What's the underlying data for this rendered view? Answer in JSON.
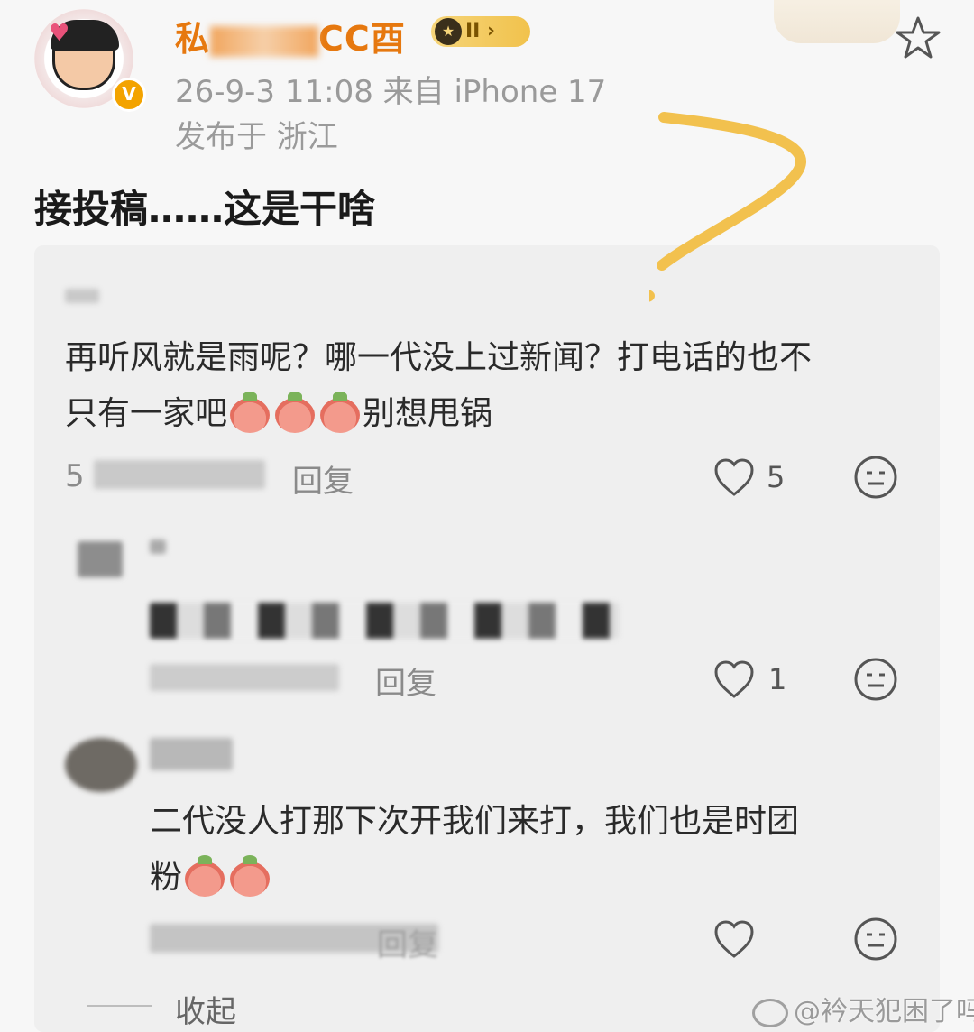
{
  "post": {
    "username_start": "私",
    "username_end": "CC酉",
    "rank_label": "II",
    "time_source": "26-9-3 11:08   来自 iPhone 17",
    "location": "发布于 浙江",
    "body": "接投稿……这是干啥"
  },
  "comments": [
    {
      "text_line1": "再听风就是雨呢？哪一代没上过新闻？打电话的也不",
      "text_line2_prefix": "只有一家吧",
      "text_line2_suffix": "别想甩锅",
      "meta_partial": "5",
      "reply_label": "回复",
      "like_count": "5"
    },
    {
      "reply_label": "回复",
      "like_count": "1"
    },
    {
      "text_line1": "二代没人打那下次开我们来打，我们也是时团",
      "text_line2": "粉",
      "reply_label": "回复",
      "like_count": ""
    }
  ],
  "collapse_label": "收起",
  "watermark": "@衿天犯困了吗",
  "colors": {
    "username": "#e6780f",
    "meta": "#9a9a9a",
    "question_mark": "#f2c14e",
    "card_bg": "#efefef"
  }
}
